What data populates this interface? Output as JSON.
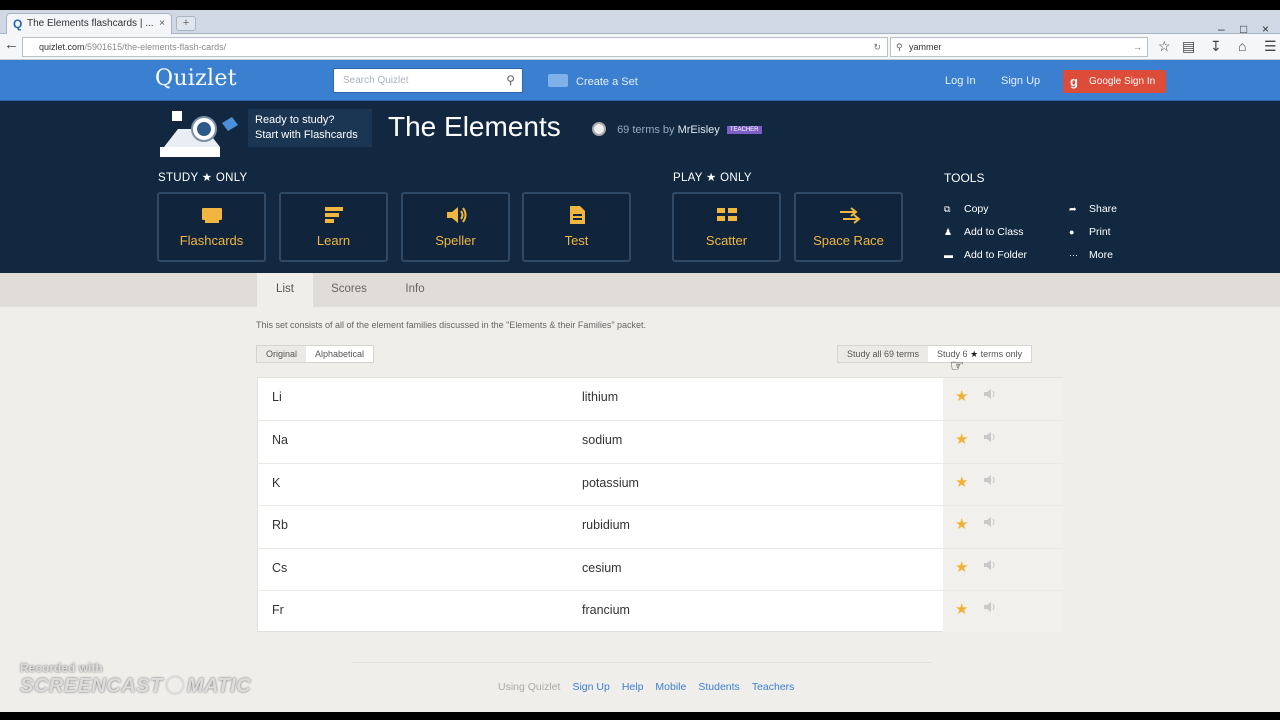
{
  "browser": {
    "tab_title": "The Elements flashcards | ...",
    "tab_close": "×",
    "new_tab": "+",
    "url_host": "quizlet.com",
    "url_path": "/5901615/the-elements-flash-cards/",
    "search_value": "yammer",
    "win_controls": [
      "–",
      "□",
      "×"
    ]
  },
  "header": {
    "logo": "Quizlet",
    "search_placeholder": "Search Quizlet",
    "create": "Create a Set",
    "login": "Log In",
    "signup": "Sign Up",
    "google": "Google Sign In",
    "google_g": "g"
  },
  "set": {
    "bubble_line1": "Ready to study?",
    "bubble_line2": "Start with Flashcards",
    "title": "The Elements",
    "terms_prefix": "69 terms by",
    "author": "MrEisley",
    "badge": "TEACHER"
  },
  "study": {
    "label": "STUDY ★ ONLY",
    "modes": [
      {
        "label": "Flashcards",
        "icon": "flashcards-icon"
      },
      {
        "label": "Learn",
        "icon": "learn-icon"
      },
      {
        "label": "Speller",
        "icon": "speller-icon"
      },
      {
        "label": "Test",
        "icon": "test-icon"
      }
    ]
  },
  "play": {
    "label": "PLAY ★ ONLY",
    "modes": [
      {
        "label": "Scatter",
        "icon": "scatter-icon"
      },
      {
        "label": "Space Race",
        "icon": "space-race-icon"
      }
    ]
  },
  "tools": {
    "heading": "TOOLS",
    "items": [
      "Copy",
      "Add to Class",
      "Add to Folder",
      "Share",
      "Print",
      "More"
    ]
  },
  "tabs": [
    "List",
    "Scores",
    "Info"
  ],
  "description": "This set consists of all of the element families discussed in the \"Elements & their Families\" packet.",
  "sort": {
    "original": "Original",
    "alphabetical": "Alphabetical"
  },
  "study_buttons": {
    "all": "Study all 69 terms",
    "starred_prefix": "Study 6",
    "starred_star": "★",
    "starred_suffix": "terms only"
  },
  "terms": [
    {
      "term": "Li",
      "definition": "lithium"
    },
    {
      "term": "Na",
      "definition": "sodium"
    },
    {
      "term": "K",
      "definition": "potassium"
    },
    {
      "term": "Rb",
      "definition": "rubidium"
    },
    {
      "term": "Cs",
      "definition": "cesium"
    },
    {
      "term": "Fr",
      "definition": "francium"
    }
  ],
  "star_glyph": "★",
  "footer": {
    "items": [
      "Using Quizlet",
      "Sign Up",
      "Help",
      "Mobile",
      "Students",
      "Teachers"
    ]
  },
  "watermark": {
    "line1": "Recorded with",
    "line2": "SCREENCAST",
    "line3": "MATIC"
  },
  "colors": {
    "brand_blue": "#3a7fd0",
    "hero_navy": "#112840",
    "mode_gold": "#f0b640",
    "star": "#f0b132",
    "google_red": "#dd4b39"
  }
}
